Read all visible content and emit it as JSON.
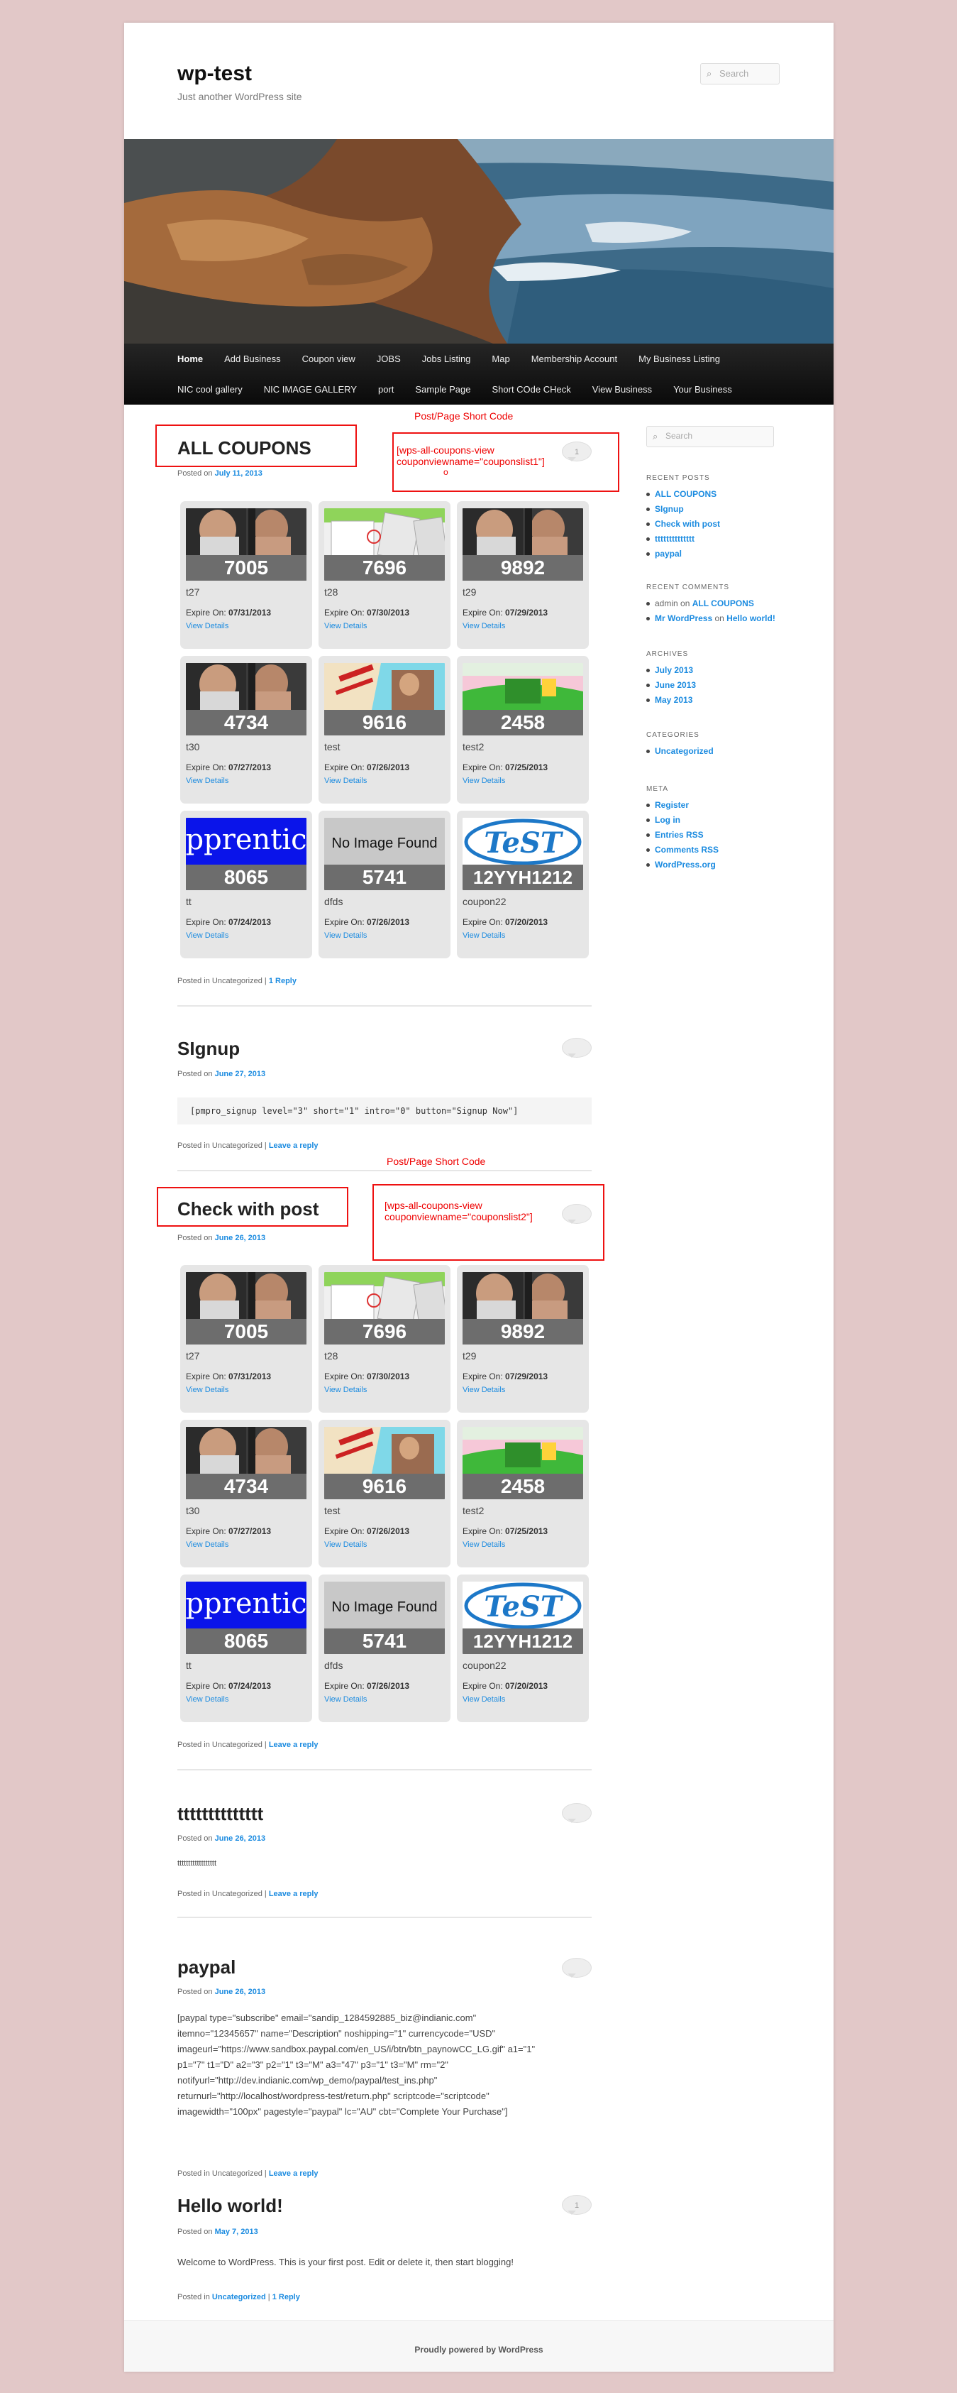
{
  "site": {
    "title": "wp-test",
    "tagline": "Just another WordPress site",
    "search_placeholder": "Search"
  },
  "nav": {
    "row1": [
      "Home",
      "Add Business",
      "Coupon view",
      "JOBS",
      "Jobs Listing",
      "Map",
      "Membership Account",
      "My Business Listing"
    ],
    "row2": [
      "NIC cool gallery",
      "NIC IMAGE GALLERY",
      "port",
      "Sample Page",
      "Short COde CHeck",
      "View Business",
      "Your Business"
    ]
  },
  "annotations": {
    "label1": "Post/Page Short Code",
    "shortcode1_line1": "[wps-all-coupons-view",
    "shortcode1_line2": "couponviewname=\"couponslist1\"]",
    "shortcode1_mark": "o",
    "label2": "Post/Page Short Code",
    "shortcode2_line1": "[wps-all-coupons-view",
    "shortcode2_line2": "couponviewname=\"couponslist2\"]"
  },
  "coupon_labels": {
    "expire_prefix": "Expire On: ",
    "view_details": "View Details"
  },
  "coupons1": [
    {
      "code": "7005",
      "title": "t27",
      "expire": "07/31/2013",
      "img": "people"
    },
    {
      "code": "7696",
      "title": "t28",
      "expire": "07/30/2013",
      "img": "screens"
    },
    {
      "code": "9892",
      "title": "t29",
      "expire": "07/29/2013",
      "img": "people"
    },
    {
      "code": "4734",
      "title": "t30",
      "expire": "07/27/2013",
      "img": "people"
    },
    {
      "code": "9616",
      "title": "test",
      "expire": "07/26/2013",
      "img": "flyer"
    },
    {
      "code": "2458",
      "title": "test2",
      "expire": "07/25/2013",
      "img": "green"
    },
    {
      "code": "8065",
      "title": "tt",
      "expire": "07/24/2013",
      "img": "apprentice"
    },
    {
      "code": "5741",
      "title": "dfds",
      "expire": "07/26/2013",
      "img": "noimage"
    },
    {
      "code": "12YYH1212",
      "title": "coupon22",
      "expire": "07/20/2013",
      "img": "test"
    }
  ],
  "coupons2": [
    {
      "code": "7005",
      "title": "t27",
      "expire": "07/31/2013",
      "img": "people"
    },
    {
      "code": "7696",
      "title": "t28",
      "expire": "07/30/2013",
      "img": "screens"
    },
    {
      "code": "9892",
      "title": "t29",
      "expire": "07/29/2013",
      "img": "people"
    },
    {
      "code": "4734",
      "title": "t30",
      "expire": "07/27/2013",
      "img": "people"
    },
    {
      "code": "9616",
      "title": "test",
      "expire": "07/26/2013",
      "img": "flyer"
    },
    {
      "code": "2458",
      "title": "test2",
      "expire": "07/25/2013",
      "img": "green"
    },
    {
      "code": "8065",
      "title": "tt",
      "expire": "07/24/2013",
      "img": "apprentice"
    },
    {
      "code": "5741",
      "title": "dfds",
      "expire": "07/26/2013",
      "img": "noimage"
    },
    {
      "code": "12YYH1212",
      "title": "coupon22",
      "expire": "07/20/2013",
      "img": "test"
    }
  ],
  "image_texts": {
    "noimage": "No Image Found",
    "apprentice": "pprentic",
    "test": "TeST"
  },
  "posts": {
    "p1": {
      "title": "ALL COUPONS",
      "posted": "Posted on ",
      "date": "July 11, 2013",
      "comments": "1",
      "footer_prefix": "Posted in Uncategorized | ",
      "footer_link": "1 Reply"
    },
    "p2": {
      "title": "SIgnup",
      "posted": "Posted on ",
      "date": "June 27, 2013",
      "code": "[pmpro_signup level=\"3\" short=\"1\" intro=\"0\" button=\"Signup Now\"]",
      "footer_prefix": "Posted in Uncategorized | ",
      "footer_link": "Leave a reply"
    },
    "p3": {
      "title": "Check with post",
      "posted": "Posted on ",
      "date": "June 26, 2013",
      "footer_prefix": "Posted in Uncategorized | ",
      "footer_link": "Leave a reply"
    },
    "p4": {
      "title": "tttttttttttttt",
      "posted": "Posted on ",
      "date": "June 26, 2013",
      "body": "tttttttttttttttttt",
      "footer_prefix": "Posted in Uncategorized | ",
      "footer_link": "Leave a reply"
    },
    "p5": {
      "title": "paypal",
      "posted": "Posted on ",
      "date": "June 26, 2013",
      "body_lines": [
        "[paypal type=\"subscribe\" email=\"sandip_1284592885_biz@indianic.com\"",
        "itemno=\"12345657\" name=\"Description\" noshipping=\"1\" currencycode=\"USD\"",
        "imageurl=\"https://www.sandbox.paypal.com/en_US/i/btn/btn_paynowCC_LG.gif\" a1=\"1\"",
        "p1=\"7\" t1=\"D\" a2=\"3\" p2=\"1\" t3=\"M\" a3=\"47\" p3=\"1\" t3=\"M\" rm=\"2\"",
        "notifyurl=\"http://dev.indianic.com/wp_demo/paypal/test_ins.php\"",
        "returnurl=\"http://localhost/wordpress-test/return.php\" scriptcode=\"scriptcode\"",
        "imagewidth=\"100px\" pagestyle=\"paypal\" lc=\"AU\" cbt=\"Complete Your Purchase\"]"
      ],
      "footer_prefix": "Posted in Uncategorized | ",
      "footer_link": "Leave a reply"
    },
    "p6": {
      "title": "Hello world!",
      "posted": "Posted on ",
      "date": "May 7, 2013",
      "comments": "1",
      "body": "Welcome to WordPress. This is your first post. Edit or delete it, then start blogging!",
      "footer_prefix": "Posted in ",
      "footer_cat": "Uncategorized",
      "footer_sep": " | ",
      "footer_link": "1 Reply"
    }
  },
  "sidebar": {
    "search_placeholder": "Search",
    "recent_posts_title": "Recent Posts",
    "recent_posts": [
      "ALL COUPONS",
      "SIgnup",
      "Check with post",
      "tttttttttttttt",
      "paypal"
    ],
    "recent_comments_title": "Recent Comments",
    "rc1": {
      "author": "admin",
      "on": " on ",
      "post": "ALL COUPONS"
    },
    "rc2": {
      "author": "Mr WordPress",
      "on": " on ",
      "post": "Hello world!"
    },
    "archives_title": "Archives",
    "archives": [
      "July 2013",
      "June 2013",
      "May 2013"
    ],
    "categories_title": "Categories",
    "categories": [
      "Uncategorized"
    ],
    "meta_title": "Meta",
    "meta": [
      "Register",
      "Log in",
      "Entries RSS",
      "Comments RSS",
      "WordPress.org"
    ]
  },
  "footer": {
    "credit": "Proudly powered by WordPress"
  },
  "colors": {
    "link": "#1b8be0",
    "annotation": "#e11111",
    "nav_bg": "#1a1a1a",
    "page_bg": "#e2c8c8"
  }
}
